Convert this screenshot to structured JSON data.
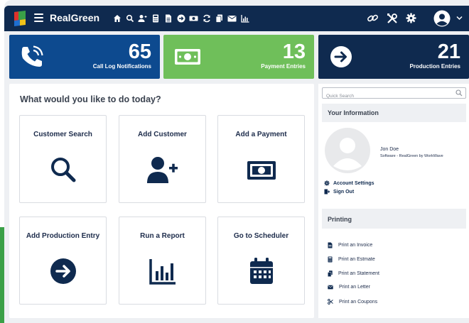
{
  "app": {
    "brand": "RealGreen"
  },
  "colors": {
    "navbar": "#0f2a4f",
    "blue": "#0d4a8f",
    "green": "#6fbf5a",
    "navy": "#0f2a4f"
  },
  "nav_icons": [
    "home-icon",
    "search-icon",
    "add-user-icon",
    "calculator-icon",
    "document-icon",
    "arrow-right-circle-icon",
    "cash-icon",
    "sync-icon",
    "copy-icon",
    "mail-icon",
    "chart-icon"
  ],
  "right_icons": [
    "link-icon",
    "tools-icon",
    "gear-icon",
    "user-circle-icon",
    "chevron-down-icon"
  ],
  "stats": [
    {
      "value": "65",
      "label": "Call Log Notifications",
      "icon": "phone-call-icon"
    },
    {
      "value": "13",
      "label": "Payment Entries",
      "icon": "cash-icon"
    },
    {
      "value": "21",
      "label": "Production Entries",
      "icon": "arrow-right-circle-icon"
    }
  ],
  "main": {
    "title": "What would you like to do today?",
    "tiles": [
      {
        "label": "Customer Search",
        "icon": "search-icon"
      },
      {
        "label": "Add Customer",
        "icon": "add-user-icon"
      },
      {
        "label": "Add a Payment",
        "icon": "cash-icon"
      },
      {
        "label": "Add Production Entry",
        "icon": "arrow-right-circle-icon"
      },
      {
        "label": "Run a Report",
        "icon": "bar-chart-icon"
      },
      {
        "label": "Go to Scheduler",
        "icon": "calendar-icon"
      }
    ]
  },
  "sidebar": {
    "search_placeholder": "Quick Search",
    "info_title": "Your Information",
    "user_name": "Jon Doe",
    "user_sub": "Software - RealGreen by WorkWave",
    "account_settings": "Account Settings",
    "sign_out": "Sign Out",
    "printing_title": "Printing",
    "print_items": [
      {
        "label": "Print an Invoice",
        "icon": "invoice-icon"
      },
      {
        "label": "Print an Estmate",
        "icon": "estimate-icon"
      },
      {
        "label": "Print an Statement",
        "icon": "copy-icon"
      },
      {
        "label": "Print an Letter",
        "icon": "mail-icon"
      },
      {
        "label": "Print an Coupons",
        "icon": "scissors-icon"
      }
    ]
  }
}
